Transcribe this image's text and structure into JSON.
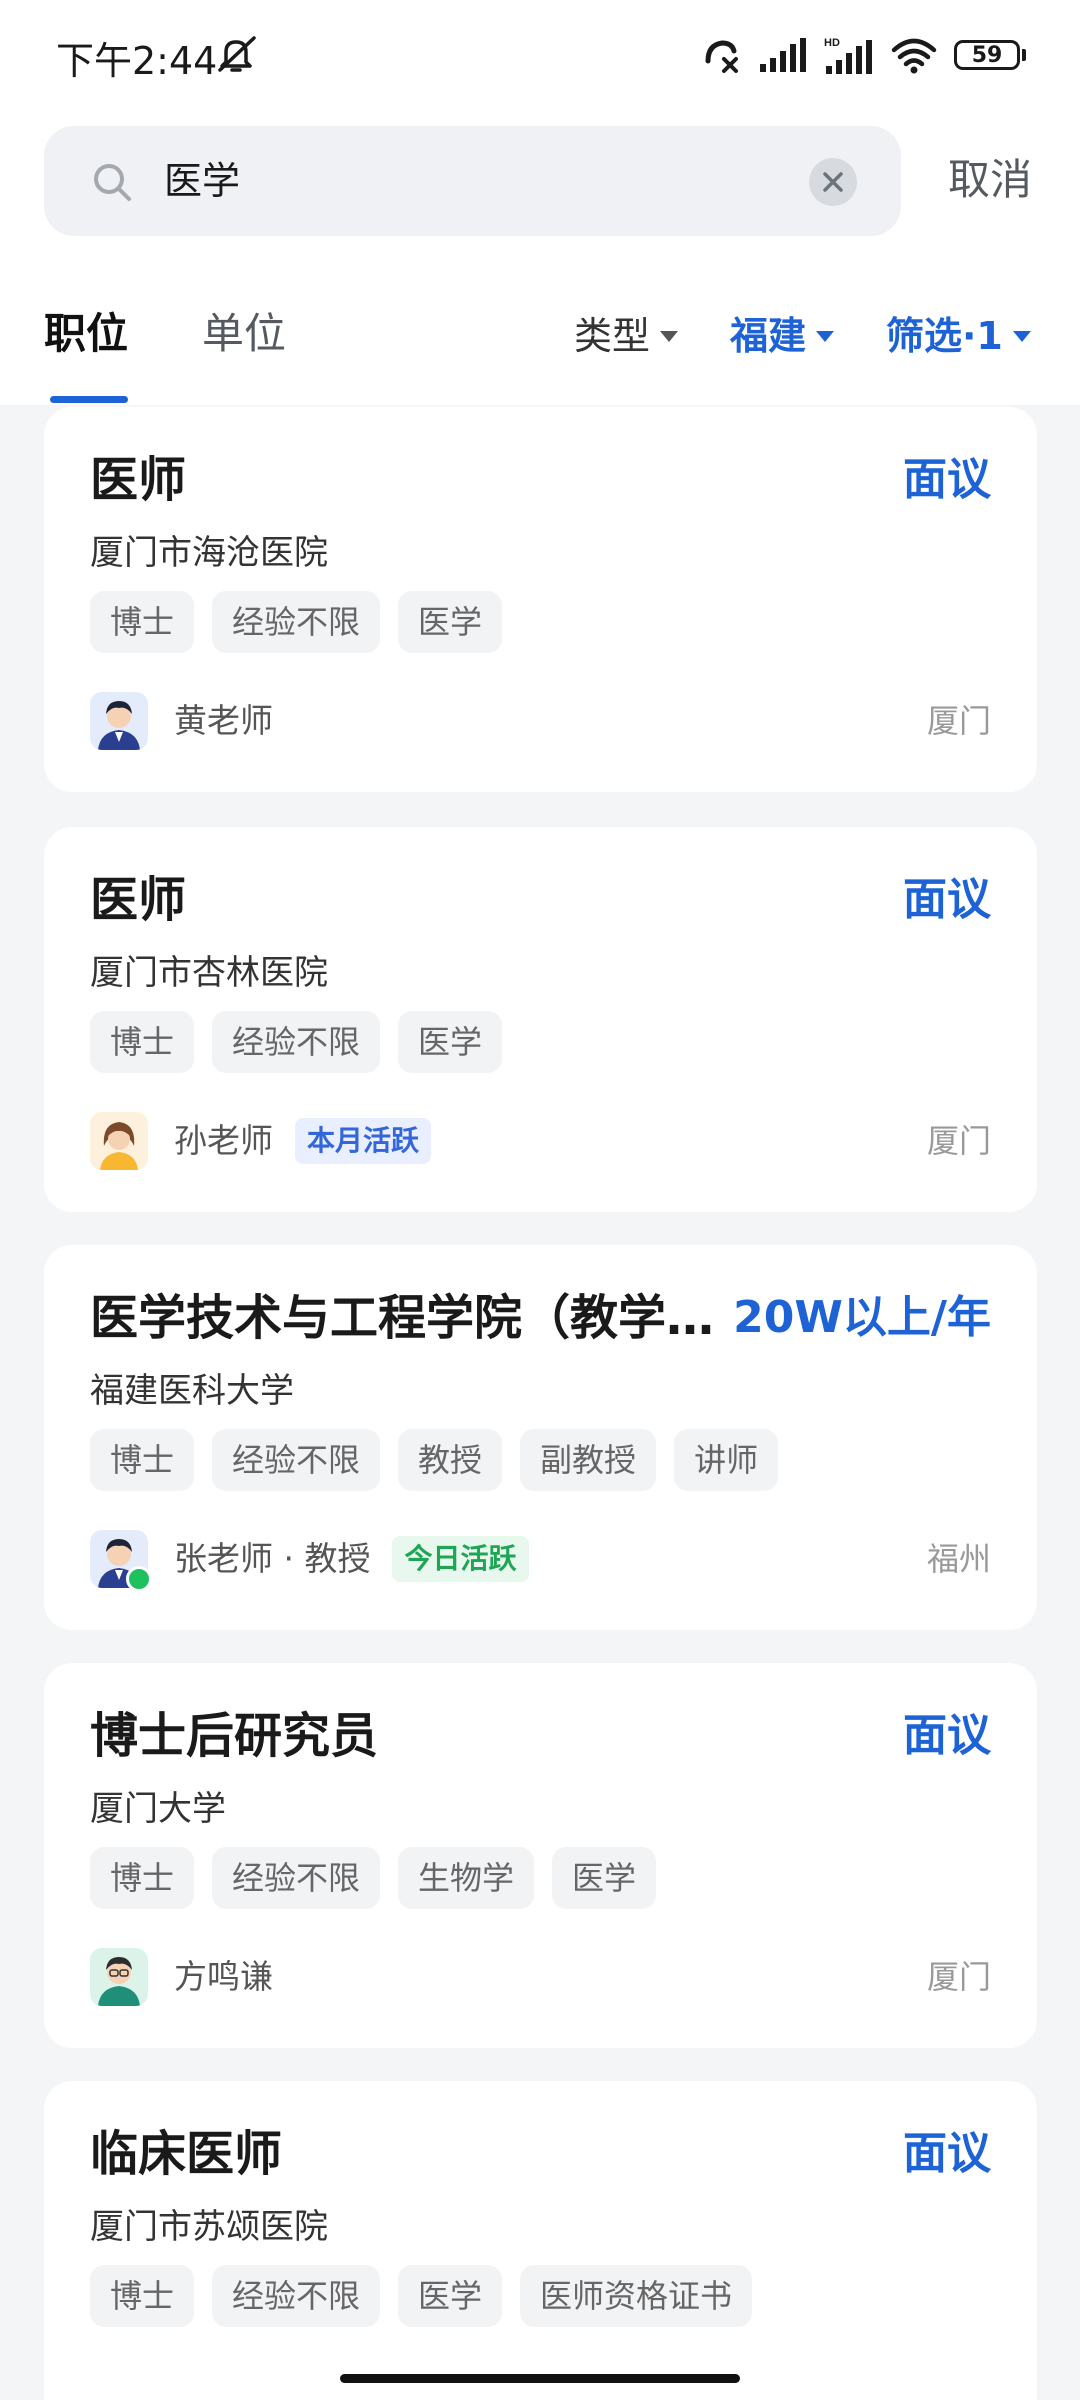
{
  "status_bar": {
    "time": "下午2:44",
    "battery": "59",
    "icons": [
      "mute-icon",
      "call-missed-icon",
      "signal-icon",
      "signal-hd-icon",
      "wifi-icon",
      "battery-icon"
    ]
  },
  "search": {
    "value": "医学",
    "cancel_label": "取消"
  },
  "tabs": [
    {
      "label": "职位",
      "active": true
    },
    {
      "label": "单位",
      "active": false
    }
  ],
  "filters": {
    "type": "类型",
    "region": "福建",
    "more": "筛选·1"
  },
  "jobs": [
    {
      "title": "医师",
      "salary": "面议",
      "org": "厦门市海沧医院",
      "tags": [
        "博士",
        "经验不限",
        "医学"
      ],
      "contact": "黄老师",
      "badge": "",
      "city": "厦门"
    },
    {
      "title": "医师",
      "salary": "面议",
      "org": "厦门市杏林医院",
      "tags": [
        "博士",
        "经验不限",
        "医学"
      ],
      "contact": "孙老师",
      "badge": "本月活跃",
      "city": "厦门"
    },
    {
      "title": "医学技术与工程学院（教学…",
      "salary": "20W以上/年",
      "org": "福建医科大学",
      "tags": [
        "博士",
        "经验不限",
        "教授",
        "副教授",
        "讲师"
      ],
      "contact": "张老师 · 教授",
      "badge": "今日活跃",
      "city": "福州"
    },
    {
      "title": "博士后研究员",
      "salary": "面议",
      "org": "厦门大学",
      "tags": [
        "博士",
        "经验不限",
        "生物学",
        "医学"
      ],
      "contact": "方鸣谦",
      "badge": "",
      "city": "厦门"
    },
    {
      "title": "临床医师",
      "salary": "面议",
      "org": "厦门市苏颂医院",
      "tags": [
        "博士",
        "经验不限",
        "医学",
        "医师资格证书"
      ]
    }
  ],
  "colors": {
    "accent": "#1e63d6",
    "page_bg": "#f3f5f7",
    "online": "#1fc15f"
  }
}
